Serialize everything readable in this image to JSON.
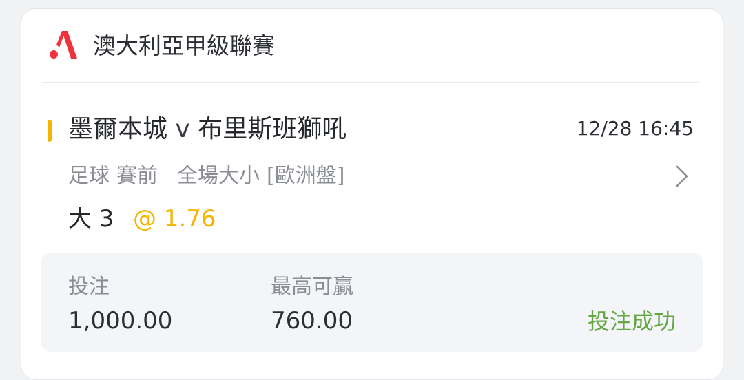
{
  "league": {
    "name": "澳大利亞甲級聯賽",
    "logo_icon": "league-logo-icon",
    "logo_color": "#f0323d"
  },
  "match": {
    "home": "墨爾本城",
    "vs": "v",
    "away": "布里斯班獅吼",
    "time": "12/28 16:45",
    "accent_color": "#f5b400"
  },
  "market": {
    "sport": "足球",
    "phase": "賽前",
    "type": "全場大小",
    "odds_format": "[歐洲盤]",
    "chevron_icon": "chevron-right-icon"
  },
  "selection": {
    "pick": "大 3",
    "odds": "@ 1.76",
    "odds_color": "#f5b400"
  },
  "summary": {
    "stake_label": "投注",
    "stake_value": "1,000.00",
    "max_win_label": "最高可贏",
    "max_win_value": "760.00",
    "status": "投注成功",
    "status_color": "#64a843"
  }
}
